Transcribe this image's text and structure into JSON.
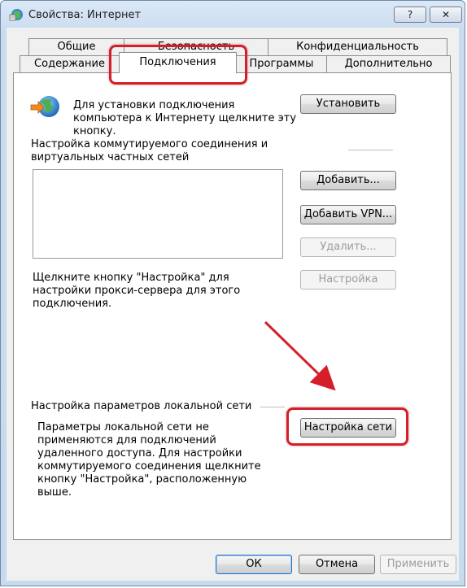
{
  "window": {
    "title": "Свойства: Интернет",
    "help_btn": "?",
    "close_btn": "✕"
  },
  "tabs": {
    "row1": [
      {
        "label": "Общие"
      },
      {
        "label": "Безопасность"
      },
      {
        "label": "Конфиденциальность"
      }
    ],
    "row2": [
      {
        "label": "Содержание"
      },
      {
        "label": "Подключения",
        "selected": true
      },
      {
        "label": "Программы"
      },
      {
        "label": "Дополнительно"
      }
    ]
  },
  "setup": {
    "text": "Для установки подключения компьютера к Интернету щелкните эту кнопку.",
    "button": "Установить"
  },
  "dialup": {
    "heading": "Настройка коммутируемого соединения и виртуальных частных сетей",
    "list_items": [],
    "add_button": "Добавить...",
    "add_vpn_button": "Добавить VPN...",
    "remove_button": "Удалить...",
    "settings_button": "Настройка",
    "proxy_hint": "Щелкните кнопку \"Настройка\" для настройки прокси-сервера для этого подключения."
  },
  "lan": {
    "heading": "Настройка параметров локальной сети",
    "description": "Параметры локальной сети не применяются для подключений удаленного доступа. Для настройки коммутируемого соединения щелкните кнопку \"Настройка\", расположенную выше.",
    "button": "Настройка сети"
  },
  "footer": {
    "ok": "ОК",
    "cancel": "Отмена",
    "apply": "Применить"
  },
  "colors": {
    "highlight": "#d51e2a",
    "window_frame": "#c7dbee"
  }
}
